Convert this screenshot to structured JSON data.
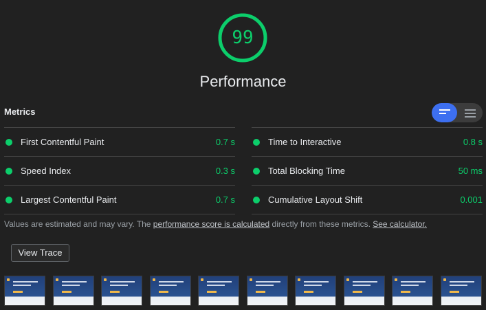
{
  "score": "99",
  "score_fraction": 0.99,
  "colors": {
    "pass": "#0cce6b",
    "accent": "#3d6ff0",
    "background": "#212121"
  },
  "category_title": "Performance",
  "metrics_header": "Metrics",
  "toggle": {
    "active": "list-view-icon",
    "inactive": "table-view-icon"
  },
  "metrics_left": [
    {
      "name": "First Contentful Paint",
      "value": "0.7 s"
    },
    {
      "name": "Speed Index",
      "value": "0.3 s"
    },
    {
      "name": "Largest Contentful Paint",
      "value": "0.7 s"
    }
  ],
  "metrics_right": [
    {
      "name": "Time to Interactive",
      "value": "0.8 s"
    },
    {
      "name": "Total Blocking Time",
      "value": "50 ms"
    },
    {
      "name": "Cumulative Layout Shift",
      "value": "0.001"
    }
  ],
  "note": {
    "prefix": "Values are estimated and may vary. The ",
    "link1": "performance score is calculated",
    "middle": " directly from these metrics. ",
    "link2": "See calculator."
  },
  "view_trace_label": "View Trace",
  "filmstrip_count": 10
}
